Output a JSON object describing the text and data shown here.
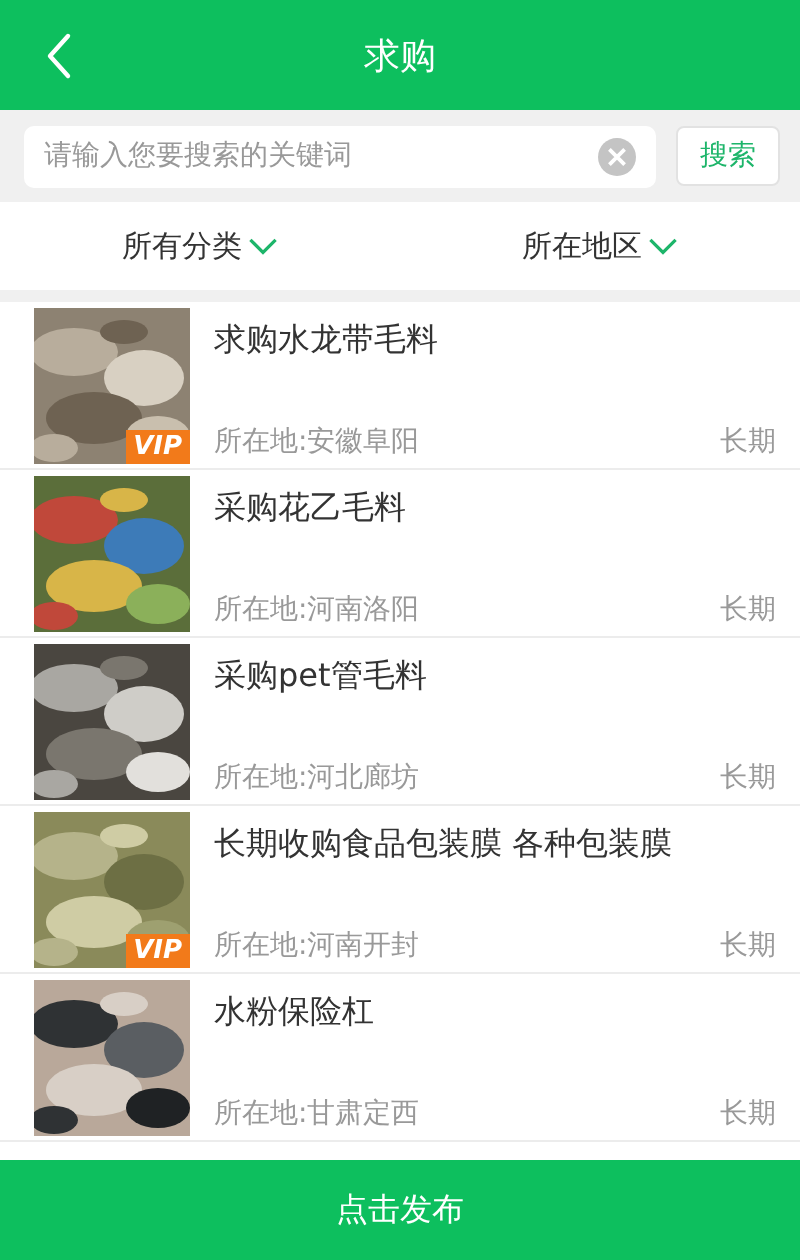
{
  "header": {
    "title": "求购"
  },
  "search": {
    "placeholder": "请输入您要搜索的关键词",
    "button": "搜索"
  },
  "filters": [
    {
      "label": "所有分类"
    },
    {
      "label": "所在地区"
    }
  ],
  "items": [
    {
      "title": "求购水龙带毛料",
      "location": "所在地:安徽阜阳",
      "term": "长期",
      "badge": "VIP"
    },
    {
      "title": "采购花乙毛料",
      "location": "所在地:河南洛阳",
      "term": "长期"
    },
    {
      "title": "采购pet管毛料",
      "location": "所在地:河北廊坊",
      "term": "长期"
    },
    {
      "title": "长期收购食品包装膜 各种包装膜",
      "location": "所在地:河南开封",
      "term": "长期",
      "badge": "VIP"
    },
    {
      "title": "水粉保险杠",
      "location": "所在地:甘肃定西",
      "term": "长期"
    }
  ],
  "bottom_button": "点击发布"
}
